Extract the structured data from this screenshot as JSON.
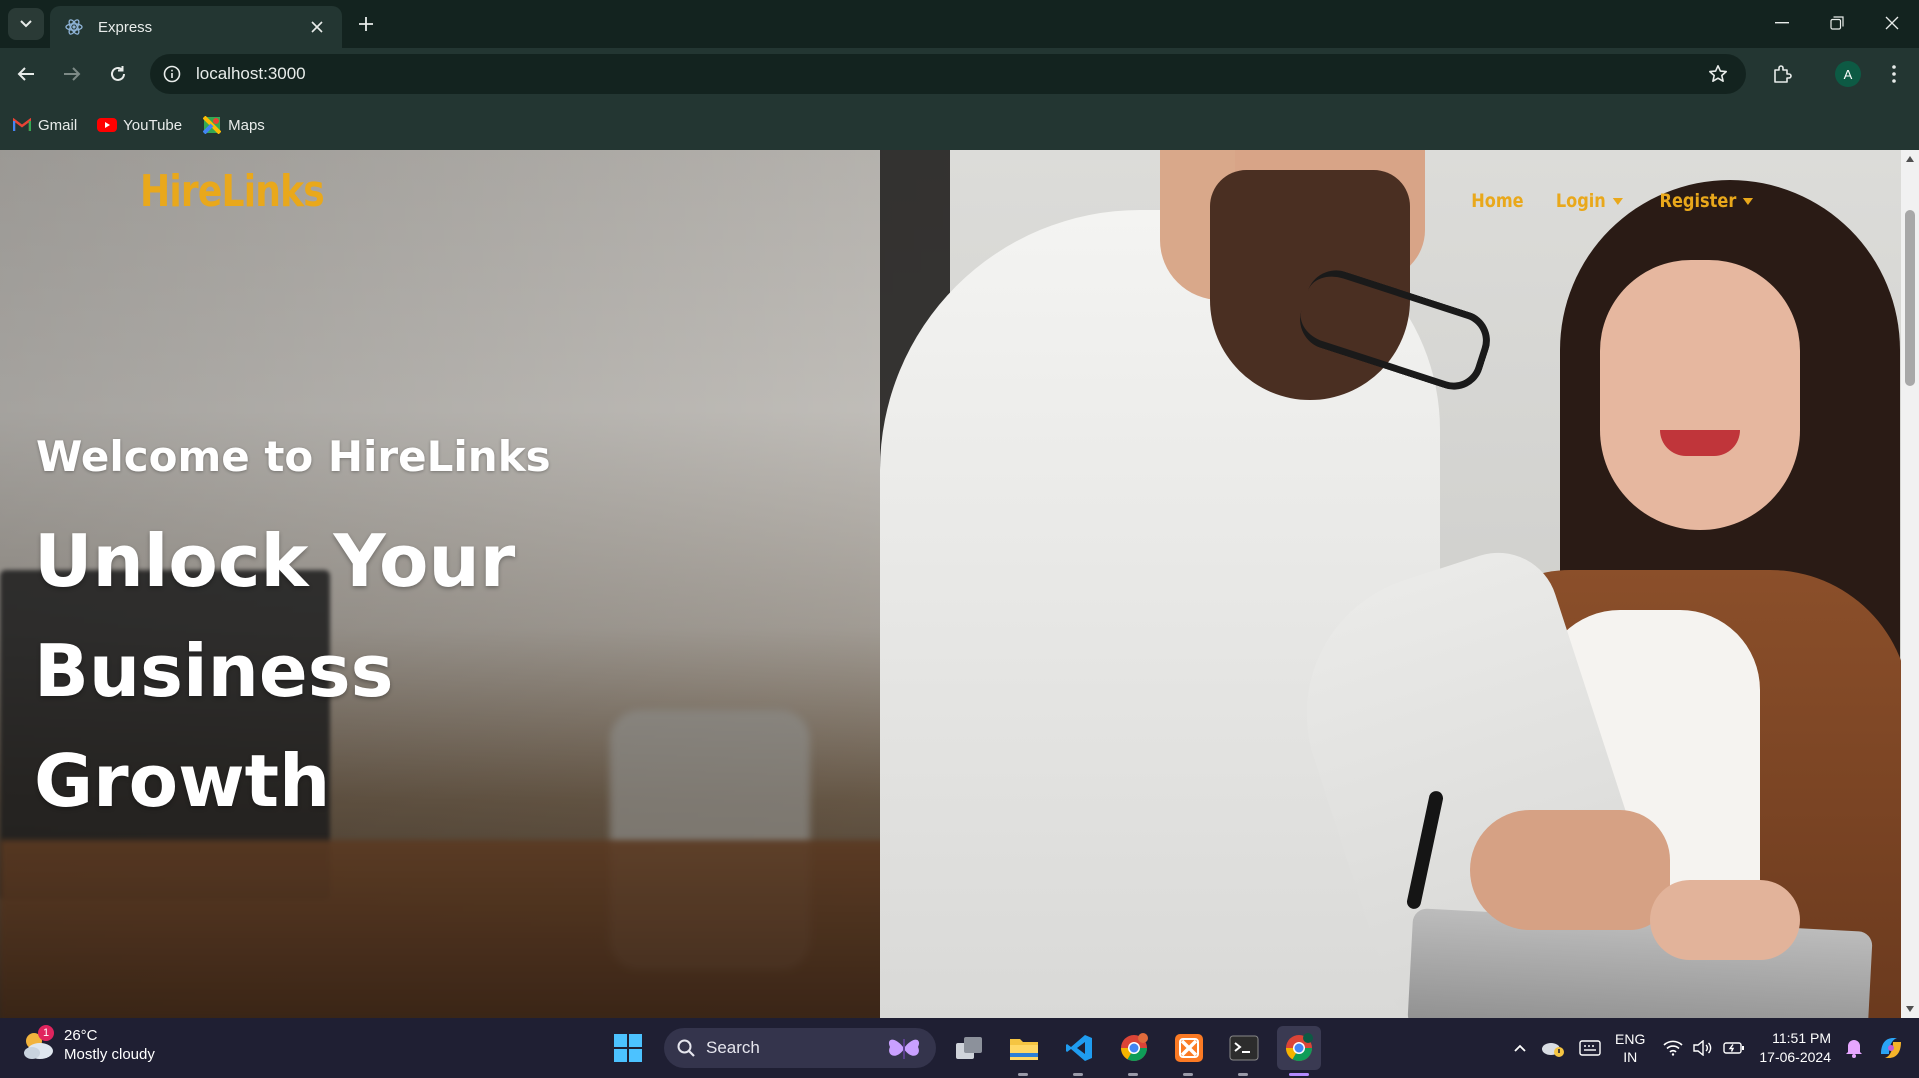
{
  "browser": {
    "tab_title": "Express",
    "url": "localhost:3000",
    "profile_initial": "A",
    "bookmarks": [
      {
        "label": "Gmail",
        "icon": "gmail-icon"
      },
      {
        "label": "YouTube",
        "icon": "youtube-icon"
      },
      {
        "label": "Maps",
        "icon": "maps-icon"
      }
    ]
  },
  "site": {
    "brand": "HireLinks",
    "nav": {
      "home": "Home",
      "login": "Login",
      "register": "Register"
    },
    "hero": {
      "welcome": "Welcome to HireLinks",
      "headline_line1": "Unlock Your Business",
      "headline_line2": "Growth"
    },
    "brand_color": "#e9a81b"
  },
  "taskbar": {
    "weather": {
      "temp": "26°C",
      "condition": "Mostly cloudy",
      "badge": "1"
    },
    "search_label": "Search",
    "language": {
      "line1": "ENG",
      "line2": "IN"
    },
    "clock": {
      "time": "11:51 PM",
      "date": "17-06-2024"
    }
  }
}
